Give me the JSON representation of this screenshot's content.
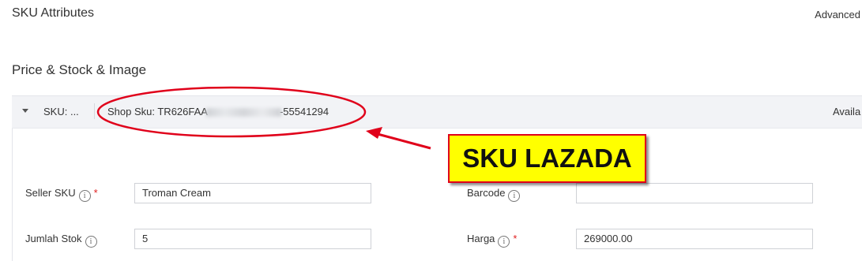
{
  "header": {
    "title": "SKU Attributes",
    "advanced_label": "Advanced"
  },
  "section": {
    "title": "Price & Stock & Image"
  },
  "sku_row": {
    "collapsed_label": "SKU: ...",
    "shop_sku_prefix": "Shop Sku: TR626FAA",
    "shop_sku_suffix": "-55541294",
    "available_label": "Availa"
  },
  "form": {
    "seller_sku": {
      "label": "Seller SKU",
      "value": "Troman Cream",
      "required": true
    },
    "barcode": {
      "label": "Barcode",
      "value": ""
    },
    "jumlah_stok": {
      "label": "Jumlah Stok",
      "value": "5"
    },
    "harga": {
      "label": "Harga",
      "value": "269000.00",
      "required": true
    },
    "info_glyph": "i",
    "required_glyph": "*"
  },
  "annotation": {
    "callout_text": "SKU LAZADA",
    "callout_color": "#ffff00",
    "ring_color": "#e0001a"
  }
}
